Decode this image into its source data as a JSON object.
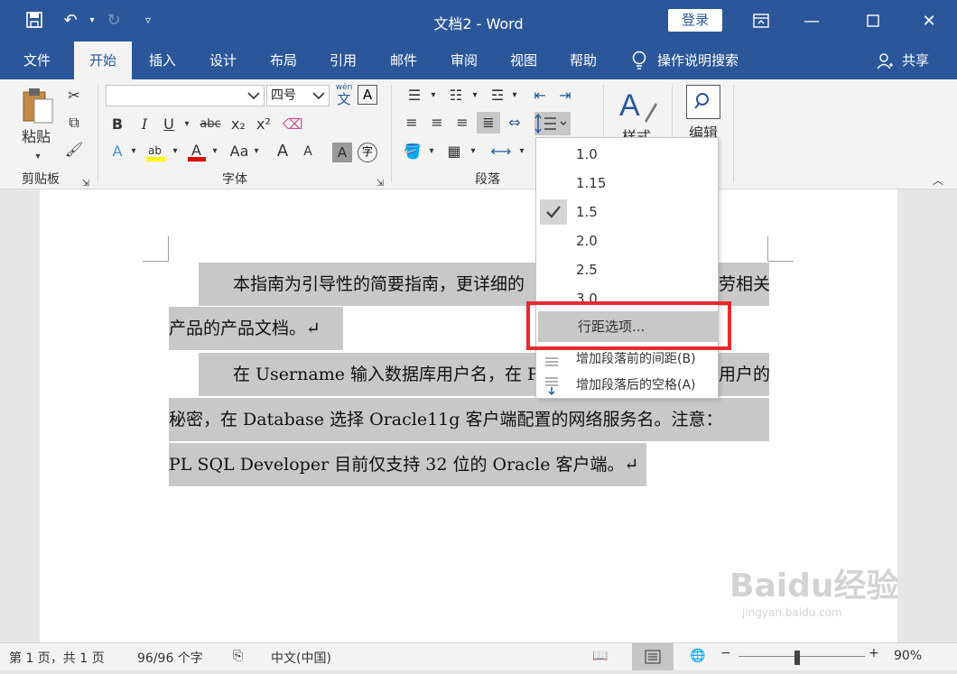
{
  "titlebar": {
    "title": "文档2 - Word",
    "login_label": "登录",
    "share_label": "共享"
  },
  "tabs": [
    "文件",
    "开始",
    "插入",
    "设计",
    "布局",
    "引用",
    "邮件",
    "审阅",
    "视图",
    "帮助"
  ],
  "active_tab": "开始",
  "tell_me": "操作说明搜索",
  "ribbon": {
    "clipboard": {
      "paste_label": "粘贴",
      "group_label": "剪贴板"
    },
    "font": {
      "font_name": "",
      "font_size": "四号",
      "group_label": "字体",
      "bold": "B",
      "italic": "I",
      "underline": "U",
      "strike": "abc",
      "sub": "x₂",
      "sup": "x²",
      "change_case": "Aa",
      "grow": "A",
      "shrink": "A",
      "wen": "文",
      "wen_top": "wén"
    },
    "paragraph": {
      "group_label": "段落"
    },
    "styles": {
      "label": "样式"
    },
    "editing": {
      "label": "编辑"
    }
  },
  "line_spacing_menu": {
    "items": [
      "1.0",
      "1.15",
      "1.5",
      "2.0",
      "2.5",
      "3.0"
    ],
    "checked": "1.5",
    "options_label": "行距选项...",
    "add_before_label": "增加段落前的间距(B)",
    "add_after_label": "增加段落后的空格(A)"
  },
  "document": {
    "lines": [
      "　　本指南为引导性的简要指南，更详细的",
      "劳相关",
      "产品的产品文档。↵",
      "　　在 Username 输入数据库用户名，在 P",
      "用户的",
      "秘密，在 Database 选择 Oracle11g 客户端配置的网络服务名。注意：",
      "PL SQL Developer 目前仅支持 32 位的 Oracle 客户端。↵"
    ]
  },
  "statusbar": {
    "page": "第 1 页，共 1 页",
    "words": "96/96 个字",
    "language": "中文(中国)",
    "zoom": "90%"
  },
  "watermark": {
    "text": "Baidu经验",
    "sub": "jingyan.baidu.com"
  },
  "colors": {
    "brand": "#2b579a",
    "highlight_box": "#e8292e",
    "selection": "#c8c8c8"
  }
}
